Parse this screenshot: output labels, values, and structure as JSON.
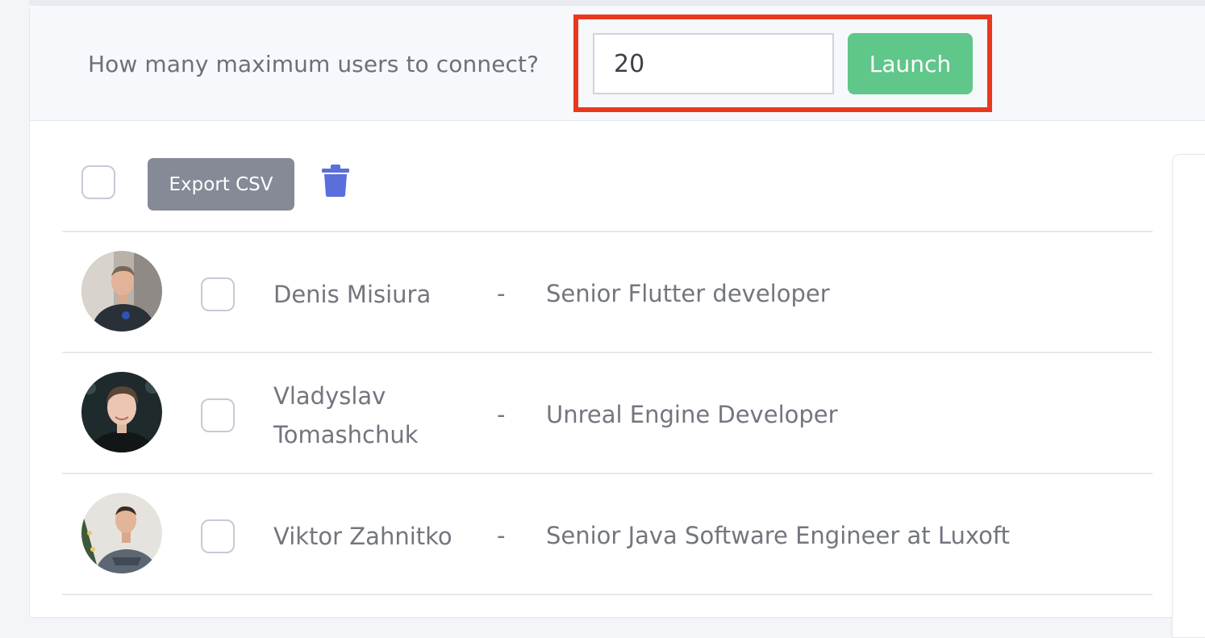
{
  "header": {
    "question": "How many maximum users to connect?",
    "max_users_value": "20",
    "launch_label": "Launch"
  },
  "toolbar": {
    "export_label": "Export CSV"
  },
  "colors": {
    "launch": "#5fc78a",
    "export": "#868a97",
    "trash": "#5a6fdc",
    "highlight": "#e8391f"
  },
  "users": [
    {
      "name": "Denis Misiura",
      "separator": "-",
      "title": "Senior Flutter developer"
    },
    {
      "name_line1": "Vladyslav",
      "name_line2": "Tomashchuk",
      "separator": "-",
      "title": "Unreal Engine Developer"
    },
    {
      "name": "Viktor Zahnitko",
      "separator": "-",
      "title": "Senior Java Software Engineer at Luxoft"
    }
  ]
}
